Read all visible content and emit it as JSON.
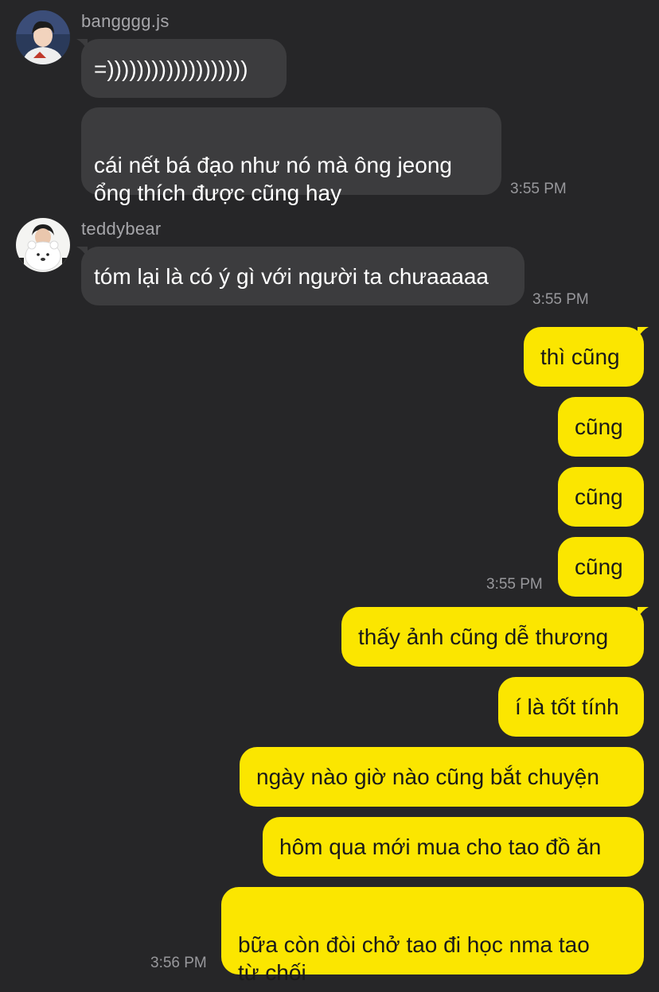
{
  "messages_in": [
    {
      "sender": "bangggg.js",
      "bubbles": [
        "=)))))))))))))))))))",
        "cái nết bá đạo như nó mà ông jeong\nổng thích được cũng hay"
      ],
      "time": "3:55 PM"
    },
    {
      "sender": "teddybear",
      "bubbles": [
        "tóm lại là có ý gì với người ta chưaaaaa"
      ],
      "time": "3:55 PM"
    }
  ],
  "messages_out": {
    "group1": [
      "thì cũng",
      "cũng",
      "cũng",
      "cũng"
    ],
    "group1_time": "3:55 PM",
    "group2": [
      "thấy ảnh cũng dễ thương",
      "í là tốt tính",
      "ngày nào giờ nào cũng bắt chuyện",
      "hôm qua mới mua cho tao đồ ăn",
      "bữa còn đòi chở tao đi học nma tao\ntừ chối"
    ],
    "group2_time": "3:56 PM"
  },
  "colors": {
    "background": "#262628",
    "incoming_bubble": "#3c3c3e",
    "outgoing_bubble": "#fbe600"
  }
}
